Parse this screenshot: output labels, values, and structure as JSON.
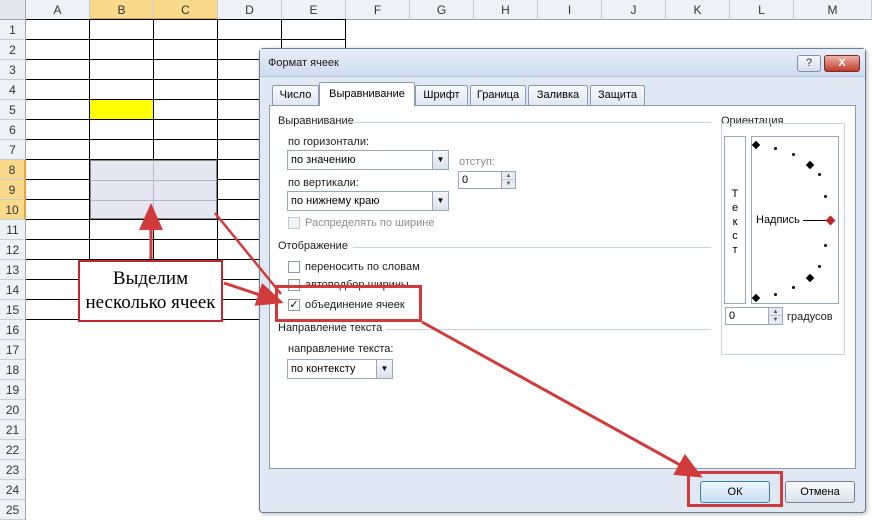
{
  "sheet": {
    "columns": [
      "A",
      "B",
      "C",
      "D",
      "E",
      "F",
      "G",
      "H",
      "I",
      "J",
      "K",
      "L",
      "M"
    ],
    "rows": [
      "1",
      "2",
      "3",
      "4",
      "5",
      "6",
      "7",
      "8",
      "9",
      "10",
      "11",
      "12",
      "13",
      "14",
      "15",
      "16",
      "17",
      "18",
      "19",
      "20",
      "21",
      "22",
      "23",
      "24",
      "25"
    ],
    "selected_columns": [
      "B",
      "C"
    ],
    "selected_rows": [
      "8",
      "9",
      "10"
    ],
    "highlight_color": "#ffff00"
  },
  "callout": {
    "line1": "Выделим",
    "line2": "несколько ячеек"
  },
  "dialog": {
    "title": "Формат ячеек",
    "help": "?",
    "close": "X",
    "tabs": [
      "Число",
      "Выравнивание",
      "Шрифт",
      "Граница",
      "Заливка",
      "Защита"
    ],
    "active_tab": "Выравнивание",
    "alignment": {
      "section": "Выравнивание",
      "horizontal_label": "по горизонтали:",
      "horizontal_value": "по значению",
      "indent_label": "отступ:",
      "indent_value": "0",
      "vertical_label": "по вертикали:",
      "vertical_value": "по нижнему краю",
      "distribute_label": "Распределять по ширине"
    },
    "display": {
      "section": "Отображение",
      "wrap_label": "переносить по словам",
      "wrap_checked": false,
      "autofit_label": "автоподбор ширины",
      "autofit_checked": false,
      "merge_label": "объединение ячеек",
      "merge_checked": true
    },
    "direction": {
      "section": "Направление текста",
      "label": "направление текста:",
      "value": "по контексту"
    },
    "orientation": {
      "section": "Ориентация",
      "vertical_text": "Т\nе\nк\nс\nт",
      "label_text": "Надпись",
      "degrees_value": "0",
      "degrees_label": "градусов"
    },
    "ok_label": "ОК",
    "cancel_label": "Отмена"
  },
  "annotation_color": "#d13a3a"
}
